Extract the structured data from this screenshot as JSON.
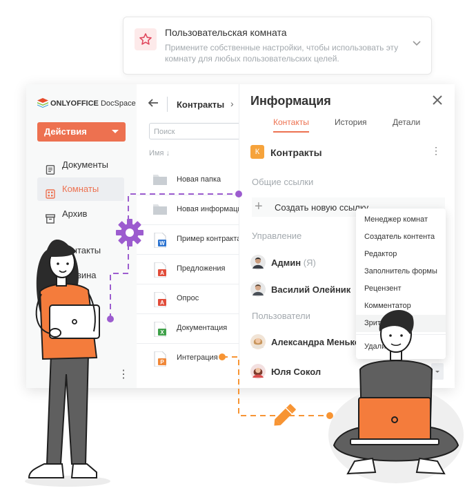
{
  "room_card": {
    "title": "Пользовательская комната",
    "description": "Примените собственные настройки, чтобы использовать эту комнату для любых пользовательских целей."
  },
  "sidebar": {
    "logo_brand": "ONLYOFFICE",
    "logo_product": "DocSpace",
    "actions_label": "Действия",
    "items": [
      {
        "label": "Документы",
        "icon": "document-icon",
        "active": false
      },
      {
        "label": "Комнаты",
        "icon": "rooms-icon",
        "active": true
      },
      {
        "label": "Архив",
        "icon": "archive-icon",
        "active": false
      },
      {
        "label": "Контакты",
        "icon": "contacts-icon",
        "active": false
      },
      {
        "label": "Корзина",
        "icon": "trash-icon",
        "active": false
      }
    ]
  },
  "files": {
    "breadcrumb": "Контракты",
    "search_placeholder": "Поиск",
    "column_name": "Имя ↓",
    "rows": [
      {
        "name": "Новая папка",
        "type": "folder"
      },
      {
        "name": "Новая информация",
        "type": "folder"
      },
      {
        "name": "Пример контракта",
        "type": "docx"
      },
      {
        "name": "Предложения",
        "type": "pdf"
      },
      {
        "name": "Опрос",
        "type": "pdf"
      },
      {
        "name": "Документация",
        "type": "xlsx"
      },
      {
        "name": "Интеграция",
        "type": "pptx"
      }
    ]
  },
  "info_panel": {
    "title": "Информация",
    "tabs": [
      "Контакты",
      "История",
      "Детали"
    ],
    "active_tab": "Контакты",
    "room_badge": "К",
    "room_name": "Контракты",
    "shared_links_title": "Общие ссылки",
    "create_link_label": "Создать новую ссылку",
    "management_title": "Управление",
    "users_title": "Пользователи",
    "managers": [
      {
        "name": "Админ",
        "suffix": "(Я)"
      },
      {
        "name": "Василий Олейник",
        "suffix": ""
      }
    ],
    "users": [
      {
        "name": "Александра Меньков",
        "suffix": ""
      },
      {
        "name": "Юля Сокол",
        "suffix": ""
      }
    ]
  },
  "role_dropdown": {
    "options": [
      "Менеджер комнат",
      "Создатель контента",
      "Редактор",
      "Заполнитель формы",
      "Рецензент",
      "Комментатор",
      "Зритель",
      "Удалить"
    ]
  },
  "colors": {
    "accent": "#ed7150",
    "purple": "#9c5ccf",
    "orange": "#f79433",
    "badge": "#f6a33b"
  }
}
